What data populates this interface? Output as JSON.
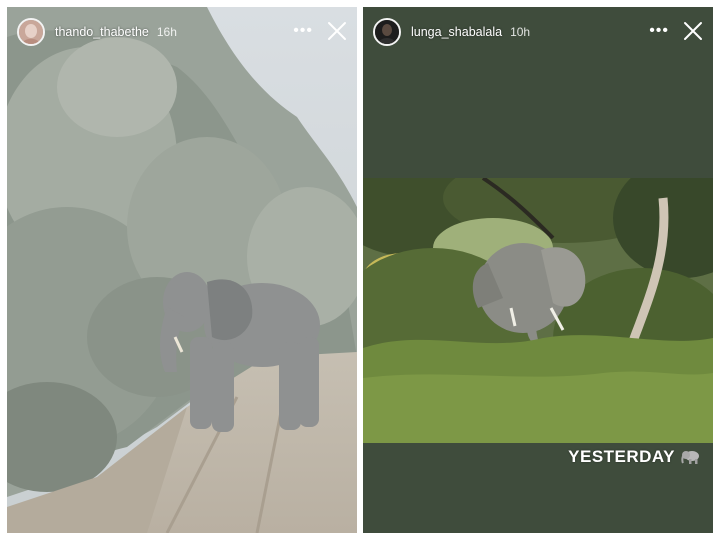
{
  "stories": [
    {
      "username": "thando_thabethe",
      "time": "16h",
      "more_label": "•••"
    },
    {
      "username": "lunga_shabalala",
      "time": "10h",
      "more_label": "•••",
      "caption": "YESTERDAY"
    }
  ],
  "colors": {
    "story_bg_right": "#3f4c3c",
    "text": "#ffffff"
  },
  "icons": {
    "close": "close-icon",
    "more": "more-options-icon",
    "avatar": "avatar",
    "sticker": "elephant-emoji-icon"
  }
}
